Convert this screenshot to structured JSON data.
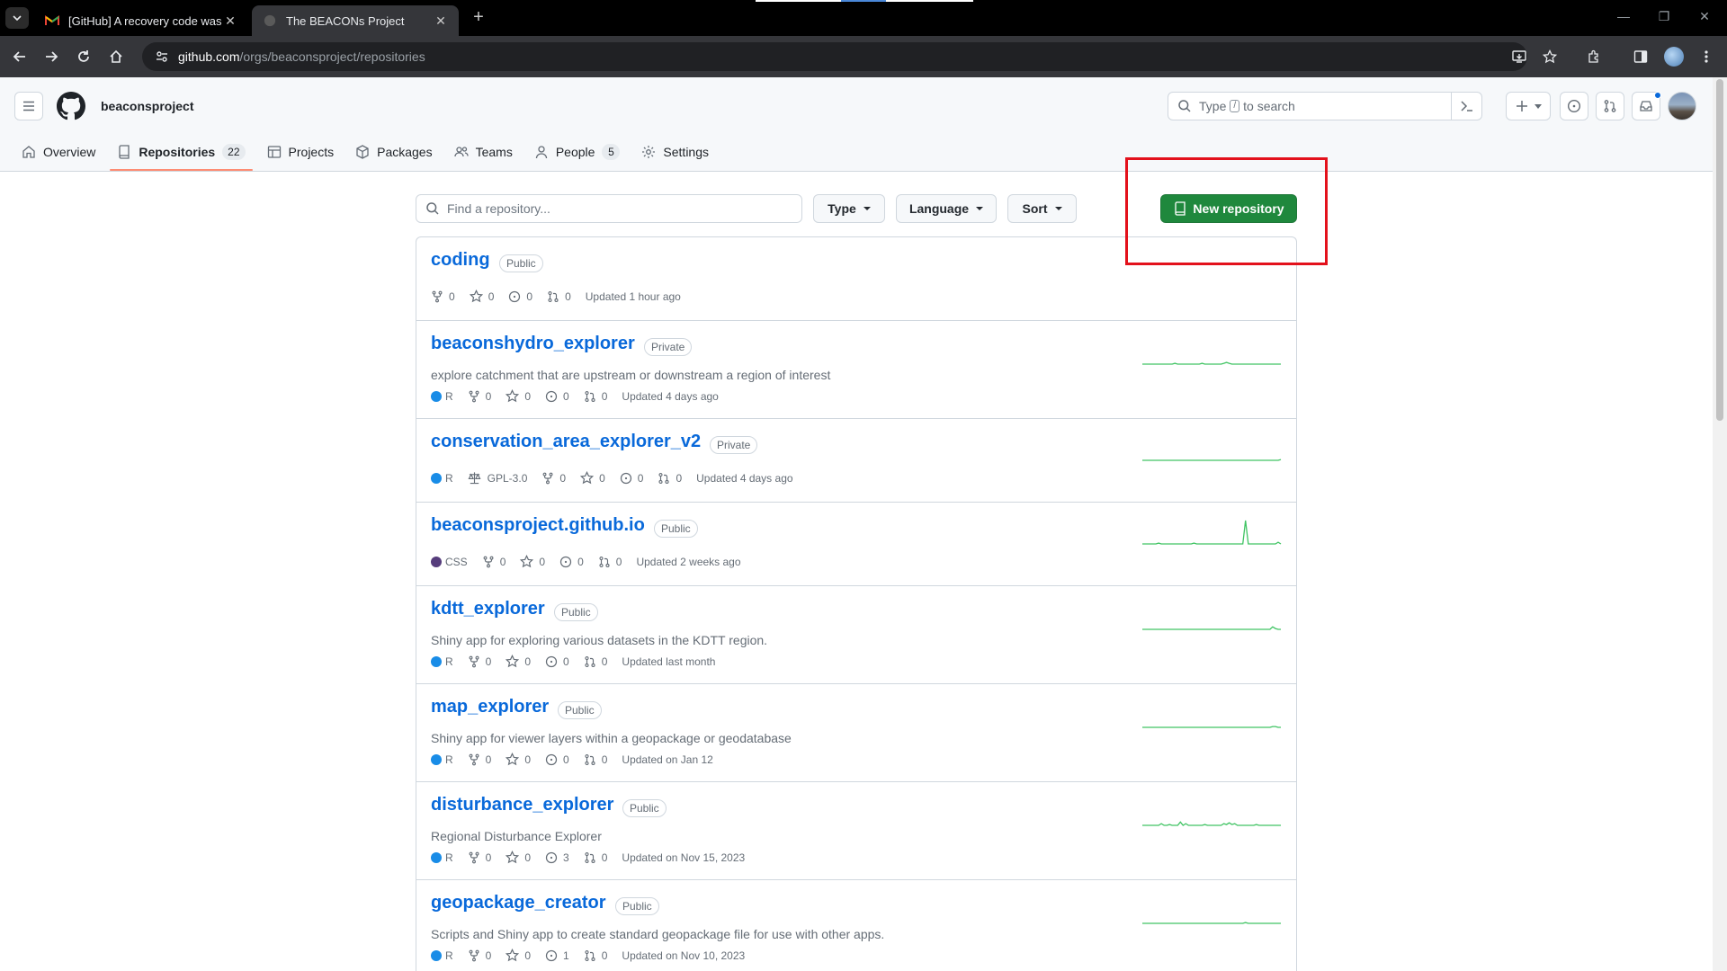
{
  "browser": {
    "tabs": [
      {
        "title": "[GitHub] A recovery code was u",
        "favicon": "gmail-icon",
        "active": false
      },
      {
        "title": "The BEACONs Project",
        "favicon": "github-icon",
        "active": true
      }
    ],
    "url_host": "github.com",
    "url_path": "/orgs/beaconsproject/repositories"
  },
  "header": {
    "org_name": "beaconsproject",
    "search_prefix": "Type",
    "search_key": "/",
    "search_suffix": "to search"
  },
  "org_nav": {
    "overview": "Overview",
    "repositories": "Repositories",
    "repositories_count": "22",
    "projects": "Projects",
    "packages": "Packages",
    "teams": "Teams",
    "people": "People",
    "people_count": "5",
    "settings": "Settings"
  },
  "filters": {
    "find_placeholder": "Find a repository...",
    "type": "Type",
    "language": "Language",
    "sort": "Sort",
    "new_repository": "New repository"
  },
  "colors": {
    "accent_green": "#1f883d",
    "link_blue": "#0969da",
    "highlight_red": "#e3111b",
    "lang_r": "#198CE7",
    "lang_css": "#563d7c",
    "spark_green": "#40c463"
  },
  "repos": [
    {
      "name": "coding",
      "visibility": "Public",
      "description": "",
      "language": "",
      "license": "",
      "forks": "0",
      "stars": "0",
      "issues": "0",
      "prs": "0",
      "updated": "Updated 1 hour ago",
      "activity": []
    },
    {
      "name": "beaconshydro_explorer",
      "visibility": "Private",
      "description": "explore catchment that are upstream or downstream a region of interest",
      "language": "R",
      "license": "",
      "forks": "0",
      "stars": "0",
      "issues": "0",
      "prs": "0",
      "updated": "Updated 4 days ago",
      "activity": [
        0,
        0,
        0,
        0,
        0,
        0,
        0,
        0,
        0,
        0,
        0,
        0,
        1,
        0,
        0,
        0,
        0,
        0,
        0,
        0,
        0,
        0,
        1,
        0,
        0,
        0,
        0,
        0,
        0,
        0,
        1,
        2,
        1,
        0,
        0,
        0,
        0,
        0,
        0,
        0,
        0,
        0,
        0,
        0,
        0,
        0,
        0,
        0,
        0,
        0,
        0,
        0
      ]
    },
    {
      "name": "conservation_area_explorer_v2",
      "visibility": "Private",
      "description": "",
      "language": "R",
      "license": "GPL-3.0",
      "forks": "0",
      "stars": "0",
      "issues": "0",
      "prs": "0",
      "updated": "Updated 4 days ago",
      "activity": [
        0,
        0,
        0,
        0,
        0,
        0,
        0,
        0,
        0,
        0,
        0,
        0,
        0,
        0,
        0,
        0,
        0,
        0,
        0,
        0,
        0,
        0,
        0,
        0,
        0,
        0,
        0,
        0,
        0,
        0,
        0,
        0,
        0,
        0,
        0,
        0,
        0,
        0,
        0,
        0,
        0,
        0,
        0,
        0,
        0,
        0,
        0,
        0,
        0,
        0,
        0,
        1
      ]
    },
    {
      "name": "beaconsproject.github.io",
      "visibility": "Public",
      "description": "",
      "language": "CSS",
      "license": "",
      "forks": "0",
      "stars": "0",
      "issues": "0",
      "prs": "0",
      "updated": "Updated 2 weeks ago",
      "activity": [
        0,
        0,
        0,
        0,
        0,
        0,
        1,
        0,
        0,
        0,
        0,
        0,
        0,
        0,
        0,
        0,
        0,
        0,
        0,
        1,
        0,
        0,
        0,
        0,
        0,
        0,
        0,
        0,
        0,
        0,
        0,
        0,
        0,
        0,
        0,
        0,
        0,
        0,
        28,
        0,
        0,
        0,
        0,
        0,
        0,
        0,
        0,
        0,
        0,
        0,
        2,
        0
      ]
    },
    {
      "name": "kdtt_explorer",
      "visibility": "Public",
      "description": "Shiny app for exploring various datasets in the KDTT region.",
      "language": "R",
      "license": "",
      "forks": "0",
      "stars": "0",
      "issues": "0",
      "prs": "0",
      "updated": "Updated last month",
      "activity": [
        0,
        0,
        0,
        0,
        0,
        0,
        0,
        0,
        0,
        0,
        0,
        0,
        0,
        0,
        0,
        0,
        0,
        0,
        0,
        0,
        0,
        0,
        0,
        0,
        0,
        0,
        0,
        0,
        0,
        0,
        0,
        0,
        0,
        0,
        0,
        0,
        0,
        0,
        0,
        0,
        0,
        0,
        0,
        0,
        0,
        0,
        0,
        0,
        3,
        1,
        0,
        0
      ]
    },
    {
      "name": "map_explorer",
      "visibility": "Public",
      "description": "Shiny app for viewer layers within a geopackage or geodatabase",
      "language": "R",
      "license": "",
      "forks": "0",
      "stars": "0",
      "issues": "0",
      "prs": "0",
      "updated": "Updated on Jan 12",
      "activity": [
        0,
        0,
        0,
        0,
        0,
        0,
        0,
        0,
        0,
        0,
        0,
        0,
        0,
        0,
        0,
        0,
        0,
        0,
        0,
        0,
        0,
        0,
        0,
        0,
        0,
        0,
        0,
        0,
        0,
        0,
        0,
        0,
        0,
        0,
        0,
        0,
        0,
        0,
        0,
        0,
        0,
        0,
        0,
        0,
        0,
        0,
        0,
        0,
        1,
        1,
        0,
        0
      ]
    },
    {
      "name": "disturbance_explorer",
      "visibility": "Public",
      "description": "Regional Disturbance Explorer",
      "language": "R",
      "license": "",
      "forks": "0",
      "stars": "0",
      "issues": "3",
      "prs": "0",
      "updated": "Updated on Nov 15, 2023",
      "activity": [
        0,
        0,
        0,
        0,
        0,
        0,
        0,
        2,
        0,
        0,
        1,
        0,
        0,
        0,
        4,
        0,
        2,
        0,
        0,
        0,
        0,
        0,
        0,
        1,
        0,
        0,
        0,
        0,
        0,
        0,
        2,
        1,
        3,
        1,
        2,
        0,
        0,
        0,
        0,
        0,
        0,
        0,
        1,
        0,
        0,
        0,
        0,
        0,
        0,
        0,
        0,
        0
      ]
    },
    {
      "name": "geopackage_creator",
      "visibility": "Public",
      "description": "Scripts and Shiny app to create standard geopackage file for use with other apps.",
      "language": "R",
      "license": "",
      "forks": "0",
      "stars": "0",
      "issues": "1",
      "prs": "0",
      "updated": "Updated on Nov 10, 2023",
      "activity": [
        0,
        0,
        0,
        0,
        0,
        0,
        0,
        0,
        0,
        0,
        0,
        0,
        0,
        0,
        0,
        0,
        0,
        0,
        0,
        0,
        0,
        0,
        0,
        0,
        0,
        0,
        0,
        0,
        0,
        0,
        0,
        0,
        0,
        0,
        0,
        0,
        0,
        0,
        1,
        0,
        0,
        0,
        0,
        0,
        0,
        0,
        0,
        0,
        0,
        0,
        0,
        0
      ]
    }
  ]
}
